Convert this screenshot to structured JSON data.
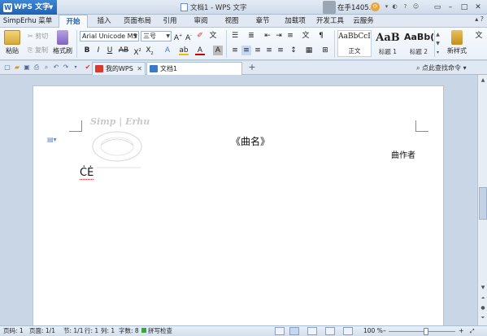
{
  "titlebar": {
    "app_button": "WPS 文字",
    "title": "文档1 - WPS 文字",
    "user_label": "在手1405..."
  },
  "menu": {
    "tabs": [
      "SimpErhu 菜单",
      "开始",
      "插入",
      "页面布局",
      "引用",
      "审阅",
      "视图",
      "章节",
      "加载项",
      "开发工具",
      "云服务"
    ],
    "active_index": 1
  },
  "ribbon": {
    "paste": "粘贴",
    "cut": "剪切",
    "copy": "复制",
    "format_painter": "格式刷",
    "font_name": "Arial Unicode MS",
    "font_size": "三号",
    "styles": [
      {
        "sample": "AaBbCcI",
        "label": "正文"
      },
      {
        "sample": "AaB",
        "label": "标题 1"
      },
      {
        "sample": "AaBb(",
        "label": "标题 2"
      }
    ],
    "new_style": "新样式"
  },
  "doctabs": {
    "tabs": [
      "我的WPS",
      "文档1"
    ],
    "active_index": 1,
    "find_placeholder": "点此查找命令"
  },
  "document": {
    "watermark_title": "Simp | Erhu",
    "heading": "《曲名》",
    "composer": "曲作者",
    "body_text": "ĊĖ"
  },
  "statusbar": {
    "page_num": "页码: 1",
    "page_of": "页面: 1/1",
    "section": "节: 1/1",
    "row": "行: 1",
    "col": "列: 1",
    "words": "字数: 8",
    "spell": "拼写检查",
    "zoom": "100 %"
  },
  "colors": {
    "accent": "#1e63b5",
    "ribbon_bg": "#eef3f9",
    "workspace": "#c9d6e6"
  }
}
